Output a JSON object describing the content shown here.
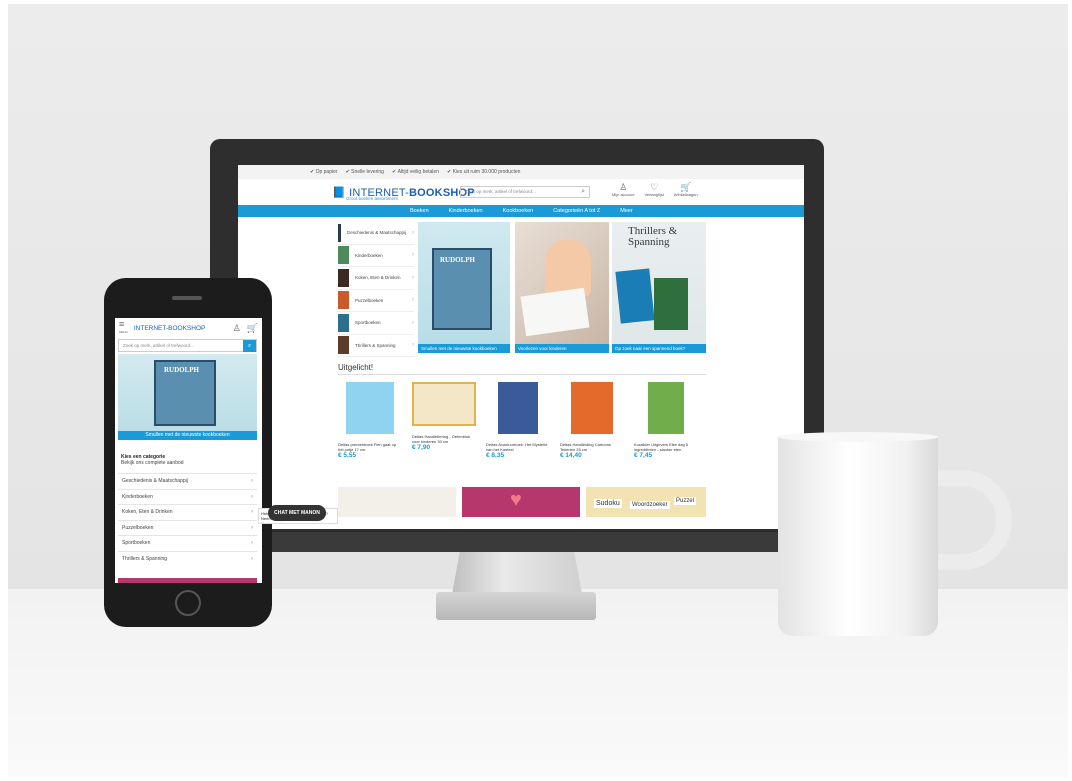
{
  "desktop": {
    "topbar": [
      "Op papier",
      "Snelle levering",
      "Altijd veilig betalen",
      "Kies uit ruim 30.000 producten"
    ],
    "logo": {
      "part1": "INTERNET-",
      "part2": "BOOKSHOP",
      "tagline": "Groot boeken assortiment"
    },
    "search_placeholder": "Zoek op merk, artikel of trefwoord...",
    "header_icons": {
      "account": "Mijn account",
      "wishlist": "Verlanglijst",
      "cart": "Winkelwagen"
    },
    "nav": [
      "Boeken",
      "Kinderboeken",
      "Kookboeken",
      "Categorieën A tot Z",
      "Meer"
    ],
    "categories": [
      "Geschiedenis & Maatschappij",
      "Kinderboeken",
      "Koken, Eten & Drinken",
      "Puzzelboeken",
      "Sportboeken",
      "Thrillers & Spanning"
    ],
    "banners": [
      {
        "cover_title": "RUDOLPH",
        "caption": "Smullen met de nieuwste kookboeken"
      },
      {
        "caption": "Voorlezen voor kinderen"
      },
      {
        "title": "Thrillers & Spanning",
        "caption": "Op zoek naar een spannend boek?"
      }
    ],
    "uitgelicht_title": "Uitgelicht!",
    "products": [
      {
        "title": "Deltas prentenboek Fien gaat op het potje 17 cm",
        "price": "€ 5,55"
      },
      {
        "title": "Deltas Handlettering - Oefenblok voor kinderen 30 cm",
        "price": "€ 7,90"
      },
      {
        "title": "Deltas Avontuurboek: Het Mysterie van het Kasteel",
        "price": "€ 8,35"
      },
      {
        "title": "Deltas Handleiding Cartoons Tekenen 25 cm",
        "price": "€ 14,40"
      },
      {
        "title": "Kuratkler Uitgevers Elke dag 5 ingrediënten - slanker eten",
        "price": "€ 7,45"
      }
    ],
    "bottom_banner_words": [
      "Sudoku",
      "Woordzoeker",
      "Puzzel"
    ]
  },
  "mobile": {
    "menu_label": "MENU",
    "logo": "INTERNET-BOOKSHOP",
    "search_placeholder": "Zoek op merk, artikel of trefwoord...",
    "banner": {
      "cover_title": "RUDOLPH",
      "caption": "Smullen met de nieuwste kookboeken"
    },
    "category_heading": "Kies een categorie",
    "category_subheading": "Bekijk ons complete aanbod",
    "categories": [
      "Geschiedenis & Maatschappij",
      "Kinderboeken",
      "Koken, Eten & Drinken",
      "Puzzelboeken",
      "Sportboeken",
      "Thrillers & Spanning"
    ]
  },
  "chat": {
    "tooltip": "Heb je hulp nodig? Heb je een vraag? Neem contact op met onze klantenservice.",
    "button": "CHAT MET MANON"
  },
  "colors": {
    "accent": "#1a9bd8",
    "logo": "#1a5fb4",
    "dark_frame": "#2e2e2e"
  }
}
